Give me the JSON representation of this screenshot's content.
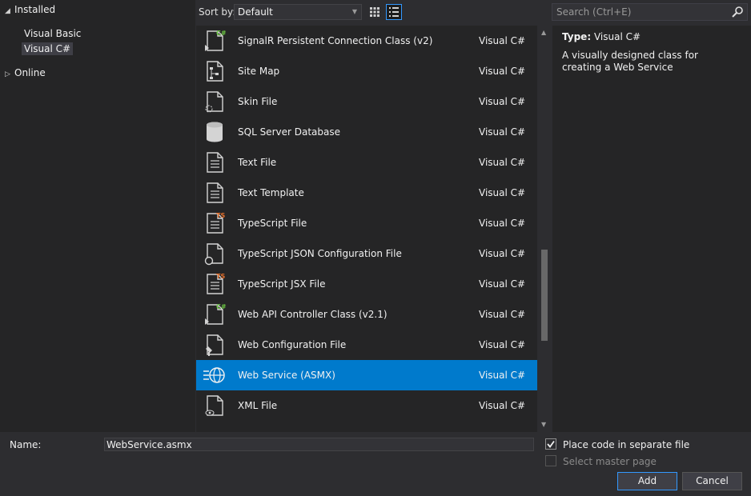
{
  "tree": {
    "installed_label": "Installed",
    "visual_basic_label": "Visual Basic",
    "visual_csharp_label": "Visual C#",
    "online_label": "Online"
  },
  "toolbar": {
    "sort_label": "Sort by:",
    "sort_value": "Default",
    "search_placeholder": "Search (Ctrl+E)"
  },
  "templates": [
    {
      "name": "SignalR Persistent Connection Class (v2)",
      "lang": "Visual C#",
      "icon": "csharp-file-icon"
    },
    {
      "name": "Site Map",
      "lang": "Visual C#",
      "icon": "sitemap-file-icon"
    },
    {
      "name": "Skin File",
      "lang": "Visual C#",
      "icon": "skin-file-icon"
    },
    {
      "name": "SQL Server Database",
      "lang": "Visual C#",
      "icon": "database-icon"
    },
    {
      "name": "Text File",
      "lang": "Visual C#",
      "icon": "text-file-icon"
    },
    {
      "name": "Text Template",
      "lang": "Visual C#",
      "icon": "text-template-icon"
    },
    {
      "name": "TypeScript File",
      "lang": "Visual C#",
      "icon": "typescript-file-icon"
    },
    {
      "name": "TypeScript JSON Configuration File",
      "lang": "Visual C#",
      "icon": "json-config-file-icon"
    },
    {
      "name": "TypeScript JSX File",
      "lang": "Visual C#",
      "icon": "typescript-jsx-file-icon"
    },
    {
      "name": "Web API Controller Class (v2.1)",
      "lang": "Visual C#",
      "icon": "csharp-file-icon"
    },
    {
      "name": "Web Configuration File",
      "lang": "Visual C#",
      "icon": "web-config-file-icon"
    },
    {
      "name": "Web Service (ASMX)",
      "lang": "Visual C#",
      "icon": "web-service-icon"
    },
    {
      "name": "XML File",
      "lang": "Visual C#",
      "icon": "xml-file-icon"
    }
  ],
  "selected_template": "Web Service (ASMX)",
  "info": {
    "type_label": "Type:",
    "type_value": "Visual C#",
    "description": "A visually designed class for creating a Web Service"
  },
  "bottom": {
    "name_label": "Name:",
    "name_value": "WebService.asmx",
    "place_code_label": "Place code in separate file",
    "place_code_checked": true,
    "master_page_label": "Select master page",
    "master_page_checked": false,
    "add_label": "Add",
    "cancel_label": "Cancel"
  },
  "colors": {
    "accent": "#007acc",
    "background": "#2d2d30",
    "panel": "#252526",
    "csharp_badge": "#6cc644",
    "ts_badge": "#e8712c"
  }
}
